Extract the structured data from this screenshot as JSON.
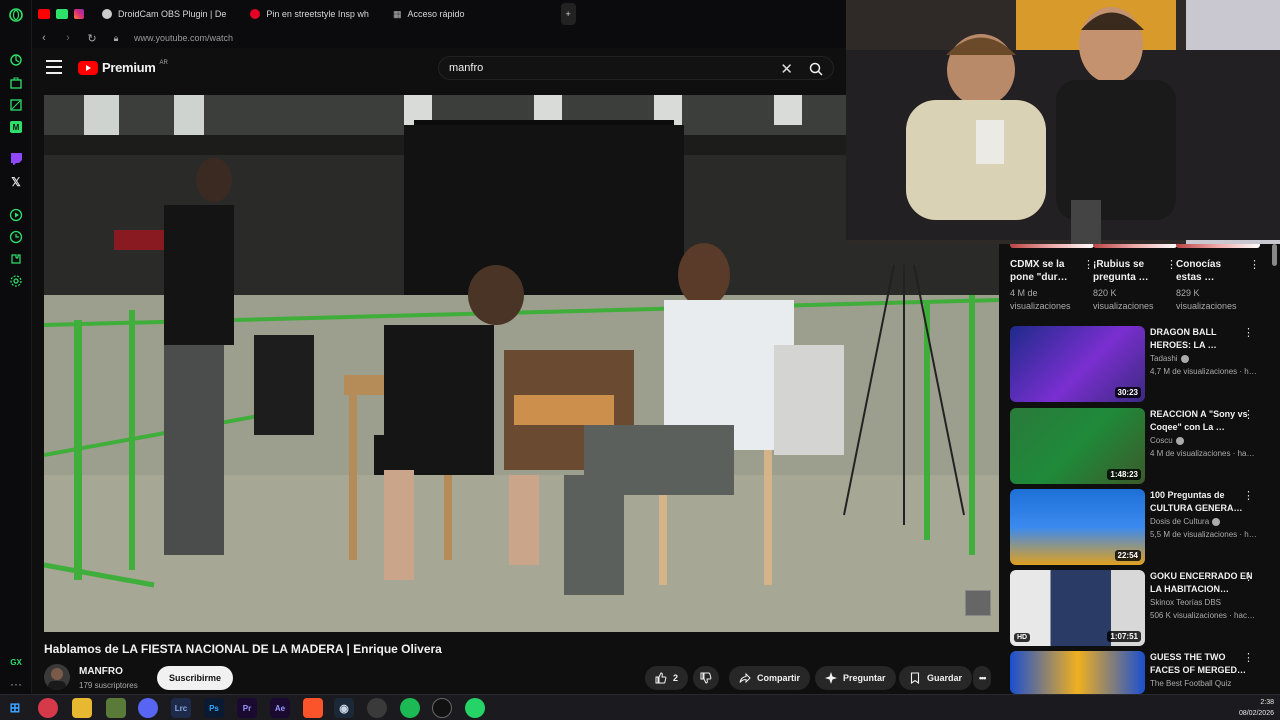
{
  "browser": {
    "tabs": [
      {
        "label": "DroidCam OBS Plugin | De"
      },
      {
        "label": "Pin en streetstyle Insp wh"
      },
      {
        "label": "Acceso rápido"
      }
    ],
    "new_tab": "+",
    "url": "www.youtube.com/watch"
  },
  "youtube": {
    "brand": "Premium",
    "region": "AR",
    "search_value": "manfro"
  },
  "video": {
    "title": "Hablamos de LA FIESTA NACIONAL DE LA MADERA | Enrique Olivera",
    "channel": "MANFRO",
    "subscribers": "179 suscriptores",
    "subscribe_label": "Suscribirme",
    "likes": "2",
    "share_label": "Compartir",
    "ask_label": "Preguntar",
    "save_label": "Guardar",
    "more_label": "•••"
  },
  "shorts": [
    {
      "title": "CDMX se la pone \"dur…",
      "views": "4 M de visualizaciones"
    },
    {
      "title": "¡Rubius se pregunta …",
      "views": "820 K visualizaciones"
    },
    {
      "title": "Conocías estas …",
      "views": "829 K visualizaciones"
    }
  ],
  "recommendations": [
    {
      "title": "DRAGON BALL HEROES: LA …",
      "channel": "Tadashi",
      "views": "4,7 M de visualizaciones · h…",
      "duration": "30:23",
      "color": "#7a2fd0"
    },
    {
      "title": "REACCION A \"Sony vs Coqee\" con La …",
      "channel": "Coscu",
      "views": "4 M de visualizaciones · ha…",
      "duration": "1:48:23",
      "color": "#1f8a3a"
    },
    {
      "title": "100 Preguntas de CULTURA GENERA…",
      "channel": "Dosis de Cultura",
      "views": "5,5 M de visualizaciones · h…",
      "duration": "22:54",
      "color": "#1e6fd6"
    },
    {
      "title": "GOKU ENCERRADO EN LA HABITACION…",
      "channel": "Skinox Teorías DBS",
      "views": "506 K visualizaciones · hac…",
      "duration": "1:07:51",
      "color": "#2a3b66",
      "badge": "HD"
    },
    {
      "title": "GUESS THE TWO FACES OF MERGED…",
      "channel": "The Best Football Quiz",
      "views": "",
      "duration": "",
      "color": "#1b4fd0"
    }
  ],
  "taskbar": {
    "apps": [
      "Lrc",
      "Ps",
      "Pr",
      "Ae"
    ],
    "time": "2:38",
    "date": "08/02/2026"
  },
  "colors": {
    "accent_green": "#2ee06a",
    "youtube_red": "#ff0000",
    "background": "#0f0f0f"
  }
}
